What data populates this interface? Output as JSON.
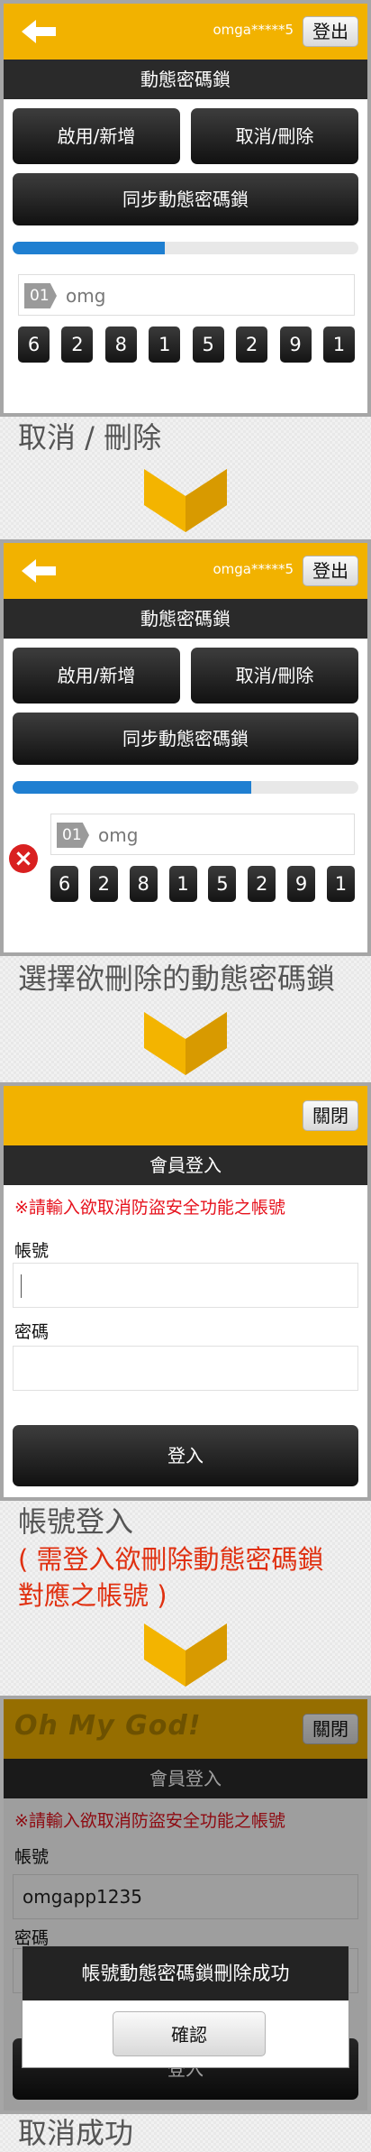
{
  "colors": {
    "accent": "#f2b200",
    "progress": "#1f7fd1",
    "warning": "#e6121d",
    "caption_highlight": "#e03010"
  },
  "icons": {
    "back": "back-arrow-icon",
    "delete": "delete-x-icon",
    "chevron": "chevron-down-icon"
  },
  "step1": {
    "username": "omga*****5",
    "logout_label": "登出",
    "page_title": "動態密碼鎖",
    "enable_add_label": "啟用/新增",
    "cancel_delete_label": "取消/刪除",
    "sync_label": "同步動態密碼鎖",
    "progress": 0.44,
    "token": {
      "index": "01",
      "name": "omg",
      "digits": [
        "6",
        "2",
        "8",
        "1",
        "5",
        "2",
        "9",
        "1"
      ]
    },
    "caption": "取消 / 刪除"
  },
  "step2": {
    "username": "omga*****5",
    "logout_label": "登出",
    "page_title": "動態密碼鎖",
    "enable_add_label": "啟用/新增",
    "cancel_delete_label": "取消/刪除",
    "sync_label": "同步動態密碼鎖",
    "progress": 0.69,
    "token": {
      "index": "01",
      "name": "omg",
      "digits": [
        "6",
        "2",
        "8",
        "1",
        "5",
        "2",
        "9",
        "1"
      ]
    },
    "caption": "選擇欲刪除的動態密碼鎖"
  },
  "step3": {
    "close_label": "關閉",
    "page_title": "會員登入",
    "warning": "※請輸入欲取消防盜安全功能之帳號",
    "account_label": "帳號",
    "account_value": "",
    "password_label": "密碼",
    "password_value": "",
    "login_label": "登入",
    "caption_line1": "帳號登入",
    "caption_line2": "( 需登入欲刪除動態密碼鎖",
    "caption_line3": "對應之帳號 )"
  },
  "step4": {
    "logo": "Oh My God!",
    "close_label": "關閉",
    "page_title": "會員登入",
    "warning": "※請輸入欲取消防盜安全功能之帳號",
    "account_label": "帳號",
    "account_value": "omgapp1235",
    "password_label": "密碼",
    "password_value": "••••••••",
    "login_label": "登入",
    "dialog_message": "帳號動態密碼鎖刪除成功",
    "dialog_ok": "確認",
    "caption": "取消成功"
  }
}
